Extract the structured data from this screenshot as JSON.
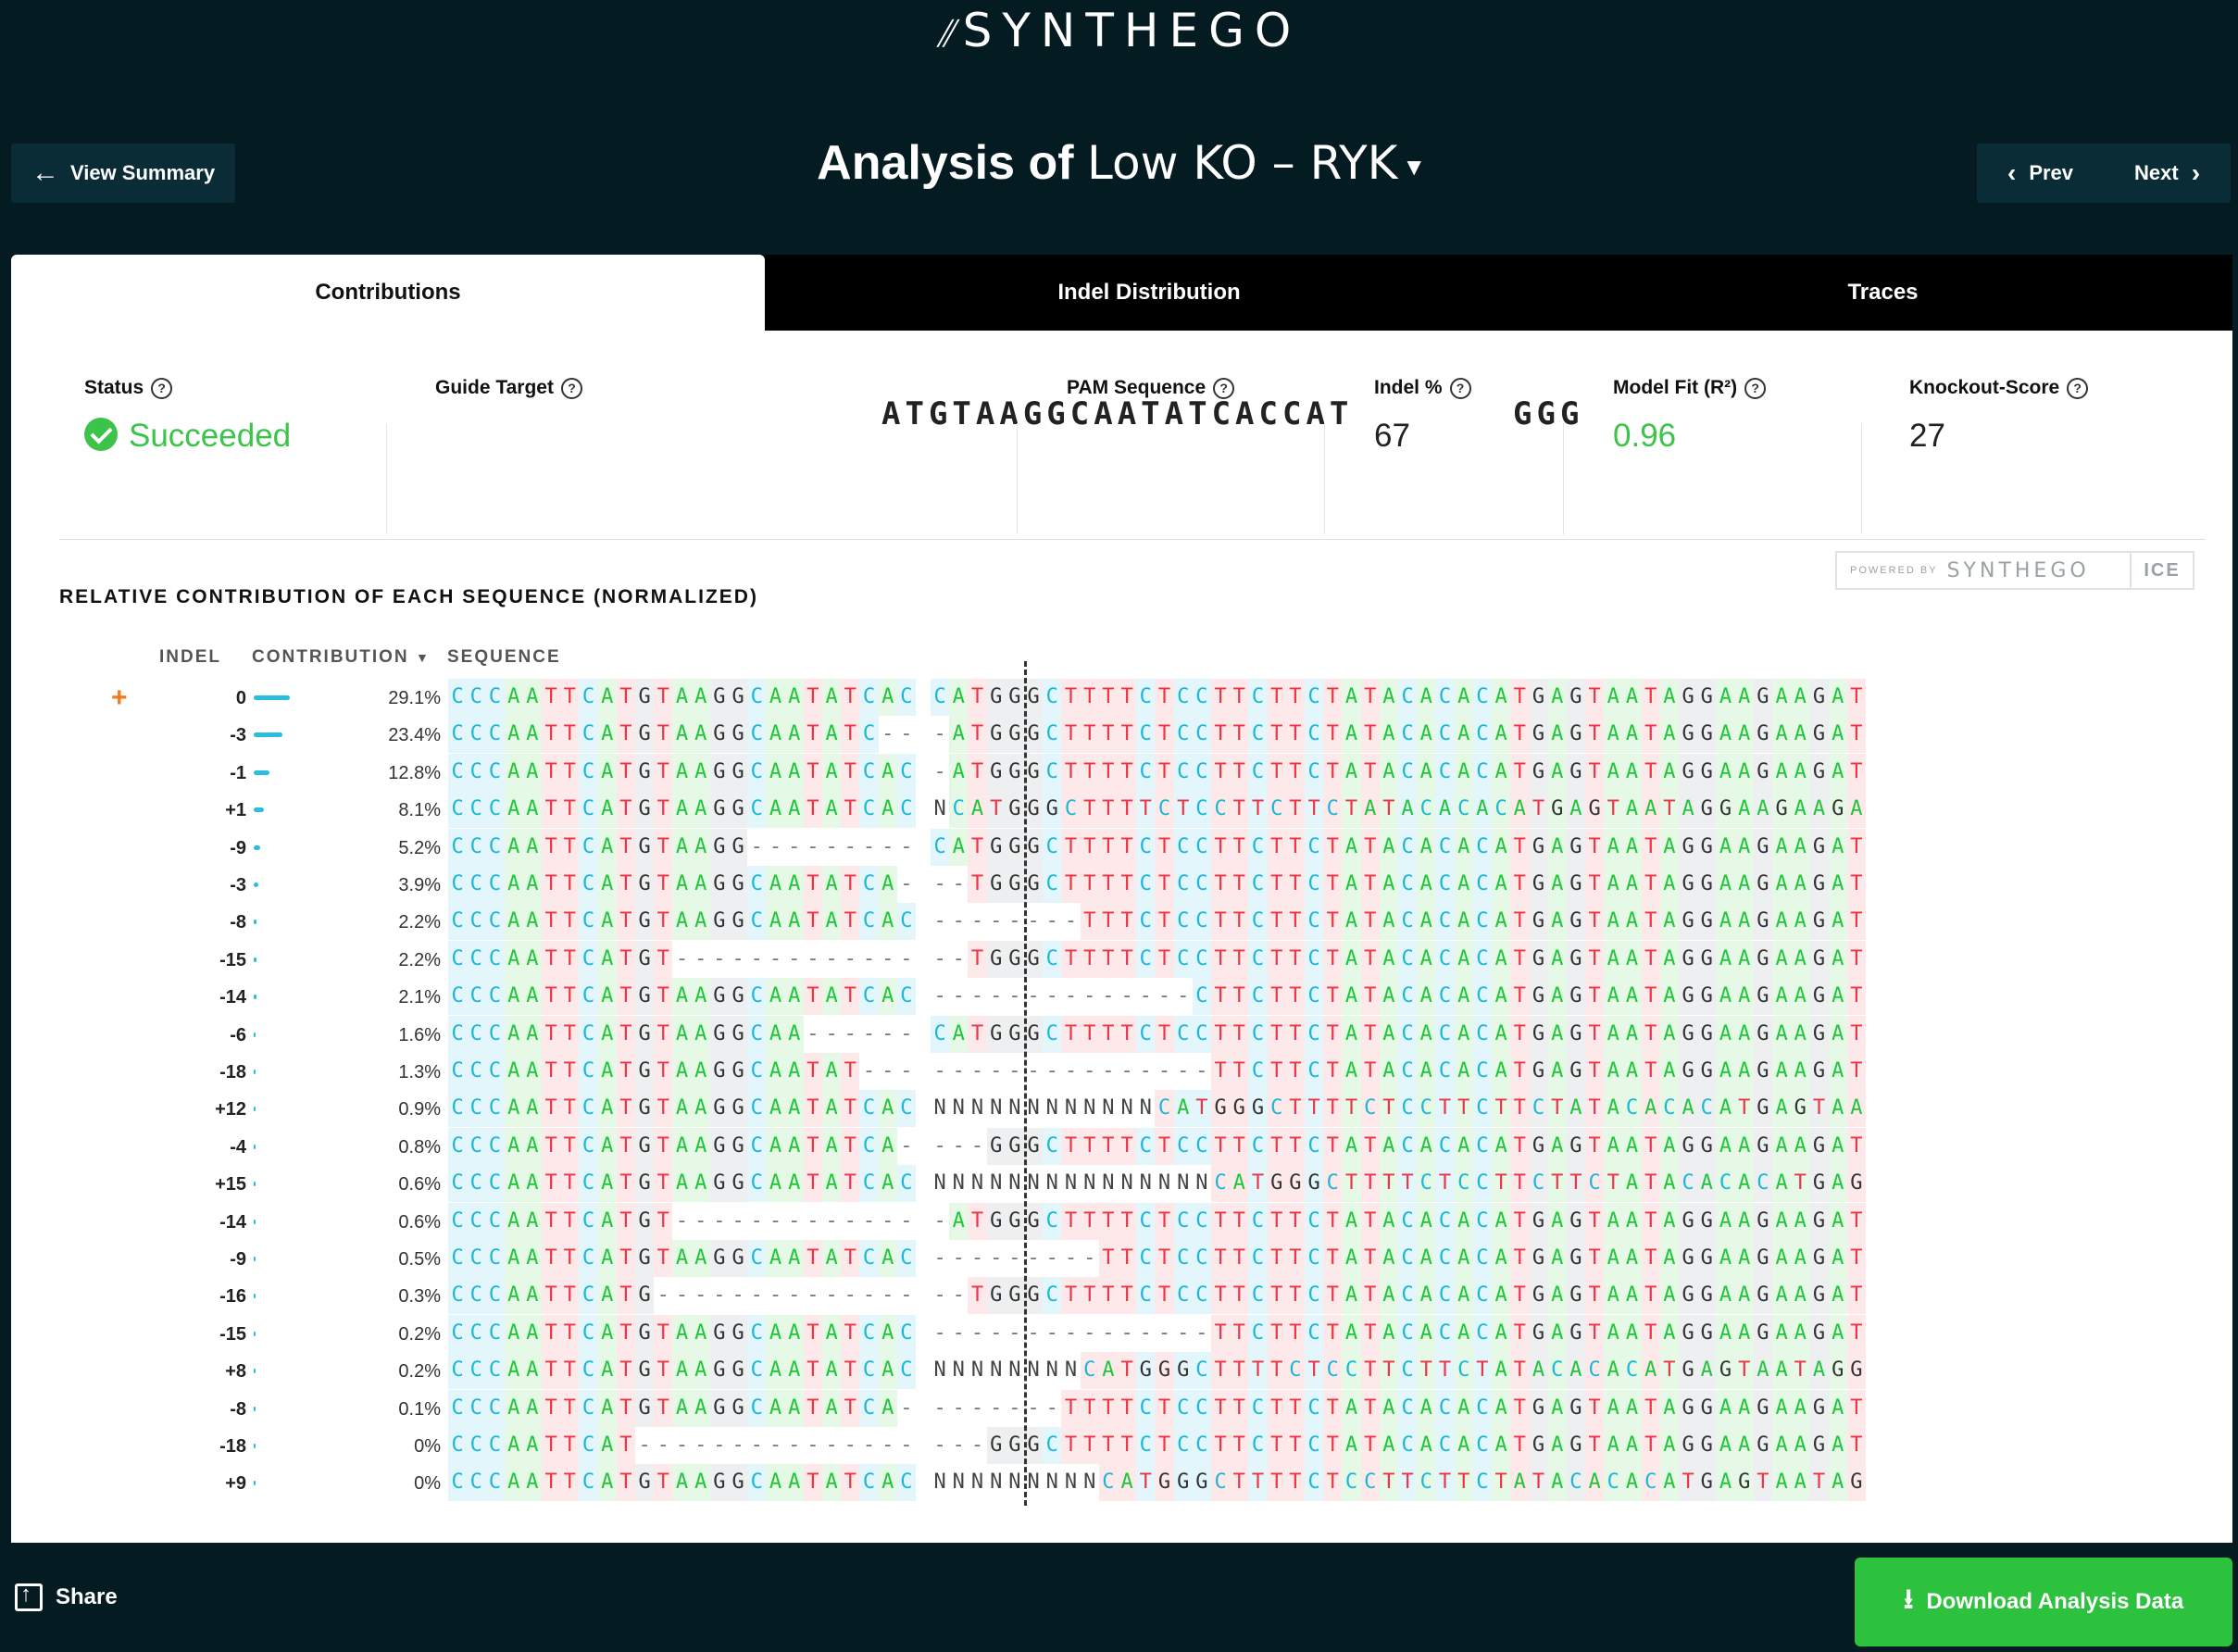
{
  "brand": {
    "logo_mark": "⫽",
    "logo_text": "SYNTHEGO"
  },
  "nav": {
    "view_summary": "View Summary",
    "prev": "Prev",
    "next": "Next"
  },
  "title": {
    "prefix": "Analysis of",
    "name": "Low KO – RYK"
  },
  "tabs": [
    "Contributions",
    "Indel Distribution",
    "Traces"
  ],
  "metrics": {
    "status": {
      "label": "Status",
      "value": "Succeeded"
    },
    "guide_target": {
      "label": "Guide Target",
      "value": "ATGTAAGGCAATATCACCAT"
    },
    "pam": {
      "label": "PAM Sequence",
      "value": "GGG"
    },
    "indel_pct": {
      "label": "Indel %",
      "value": "67"
    },
    "model_fit": {
      "label": "Model Fit (R²)",
      "value": "0.96"
    },
    "ko_score": {
      "label": "Knockout-Score",
      "value": "27"
    }
  },
  "powered": {
    "by": "POWERED BY",
    "brand": "SYNTHEGO",
    "product": "ICE"
  },
  "section_title": "RELATIVE CONTRIBUTION OF EACH SEQUENCE (NORMALIZED)",
  "columns": {
    "indel": "INDEL",
    "contribution": "CONTRIBUTION",
    "sequence": "SEQUENCE"
  },
  "rows": [
    {
      "indel": "0",
      "pct": 29.1,
      "label": "29.1%",
      "seq": "CCCAATTCATGTAAGGCAATATCAC|CATGGGCTTTTCTCCTTCTTCTATACACACATGAGTAATAGGAAGAAGAT"
    },
    {
      "indel": "-3",
      "pct": 23.4,
      "label": "23.4%",
      "seq": "CCCAATTCATGTAAGGCAATATC--|-ATGGGCTTTTCTCCTTCTTCTATACACACATGAGTAATAGGAAGAAGAT"
    },
    {
      "indel": "-1",
      "pct": 12.8,
      "label": "12.8%",
      "seq": "CCCAATTCATGTAAGGCAATATCAC|-ATGGGCTTTTCTCCTTCTTCTATACACACATGAGTAATAGGAAGAAGAT"
    },
    {
      "indel": "+1",
      "pct": 8.1,
      "label": "8.1%",
      "seq": "CCCAATTCATGTAAGGCAATATCAC|NCATGGGCTTTTCTCCTTCTTCTATACACACATGAGTAATAGGAAGAAGA"
    },
    {
      "indel": "-9",
      "pct": 5.2,
      "label": "5.2%",
      "seq": "CCCAATTCATGTAAGG---------|CATGGGCTTTTCTCCTTCTTCTATACACACATGAGTAATAGGAAGAAGAT"
    },
    {
      "indel": "-3",
      "pct": 3.9,
      "label": "3.9%",
      "seq": "CCCAATTCATGTAAGGCAATATCA-|--TGGGCTTTTCTCCTTCTTCTATACACACATGAGTAATAGGAAGAAGAT"
    },
    {
      "indel": "-8",
      "pct": 2.2,
      "label": "2.2%",
      "seq": "CCCAATTCATGTAAGGCAATATCAC|--------TTTCTCCTTCTTCTATACACACATGAGTAATAGGAAGAAGAT"
    },
    {
      "indel": "-15",
      "pct": 2.2,
      "label": "2.2%",
      "seq": "CCCAATTCATGT-------------|--TGGGCTTTTCTCCTTCTTCTATACACACATGAGTAATAGGAAGAAGAT"
    },
    {
      "indel": "-14",
      "pct": 2.1,
      "label": "2.1%",
      "seq": "CCCAATTCATGTAAGGCAATATCAC|--------------CTTCTTCTATACACACATGAGTAATAGGAAGAAGAT"
    },
    {
      "indel": "-6",
      "pct": 1.6,
      "label": "1.6%",
      "seq": "CCCAATTCATGTAAGGCAA------|CATGGGCTTTTCTCCTTCTTCTATACACACATGAGTAATAGGAAGAAGAT"
    },
    {
      "indel": "-18",
      "pct": 1.3,
      "label": "1.3%",
      "seq": "CCCAATTCATGTAAGGCAATAT---|---------------TTCTTCTATACACACATGAGTAATAGGAAGAAGAT"
    },
    {
      "indel": "+12",
      "pct": 0.9,
      "label": "0.9%",
      "seq": "CCCAATTCATGTAAGGCAATATCAC|NNNNNNNNNNNNCATGGGCTTTTCTCCTTCTTCTATACACACATGAGTAA"
    },
    {
      "indel": "-4",
      "pct": 0.8,
      "label": "0.8%",
      "seq": "CCCAATTCATGTAAGGCAATATCA-|---GGGCTTTTCTCCTTCTTCTATACACACATGAGTAATAGGAAGAAGAT"
    },
    {
      "indel": "+15",
      "pct": 0.6,
      "label": "0.6%",
      "seq": "CCCAATTCATGTAAGGCAATATCAC|NNNNNNNNNNNNNNNCATGGGCTTTTCTCCTTCTTCTATACACACATGAG"
    },
    {
      "indel": "-14",
      "pct": 0.6,
      "label": "0.6%",
      "seq": "CCCAATTCATGT-------------|-ATGGGCTTTTCTCCTTCTTCTATACACACATGAGTAATAGGAAGAAGAT"
    },
    {
      "indel": "-9",
      "pct": 0.5,
      "label": "0.5%",
      "seq": "CCCAATTCATGTAAGGCAATATCAC|---------TTCTCCTTCTTCTATACACACATGAGTAATAGGAAGAAGAT"
    },
    {
      "indel": "-16",
      "pct": 0.3,
      "label": "0.3%",
      "seq": "CCCAATTCATG--------------|--TGGGCTTTTCTCCTTCTTCTATACACACATGAGTAATAGGAAGAAGAT"
    },
    {
      "indel": "-15",
      "pct": 0.2,
      "label": "0.2%",
      "seq": "CCCAATTCATGTAAGGCAATATCAC|---------------TTCTTCTATACACACATGAGTAATAGGAAGAAGAT"
    },
    {
      "indel": "+8",
      "pct": 0.2,
      "label": "0.2%",
      "seq": "CCCAATTCATGTAAGGCAATATCAC|NNNNNNNNCATGGGCTTTTCTCCTTCTTCTATACACACATGAGTAATAGG"
    },
    {
      "indel": "-8",
      "pct": 0.1,
      "label": "0.1%",
      "seq": "CCCAATTCATGTAAGGCAATATCA-|-------TTTTCTCCTTCTTCTATACACACATGAGTAATAGGAAGAAGAT"
    },
    {
      "indel": "-18",
      "pct": 0,
      "label": "0%",
      "seq": "CCCAATTCAT---------------|---GGGCTTTTCTCCTTCTTCTATACACACATGAGTAATAGGAAGAAGAT"
    },
    {
      "indel": "+9",
      "pct": 0,
      "label": "0%",
      "seq": "CCCAATTCATGTAAGGCAATATCAC|NNNNNNNNNCATGGGCTTTTCTCCTTCTTCTATACACACATGAGTAATAG"
    }
  ],
  "footer": {
    "share": "Share",
    "download": "Download Analysis Data"
  },
  "colors": {
    "background": "#041b22",
    "accent_green": "#2cc23e",
    "bar_blue": "#29bde0",
    "plus_orange": "#ee7b1d"
  }
}
